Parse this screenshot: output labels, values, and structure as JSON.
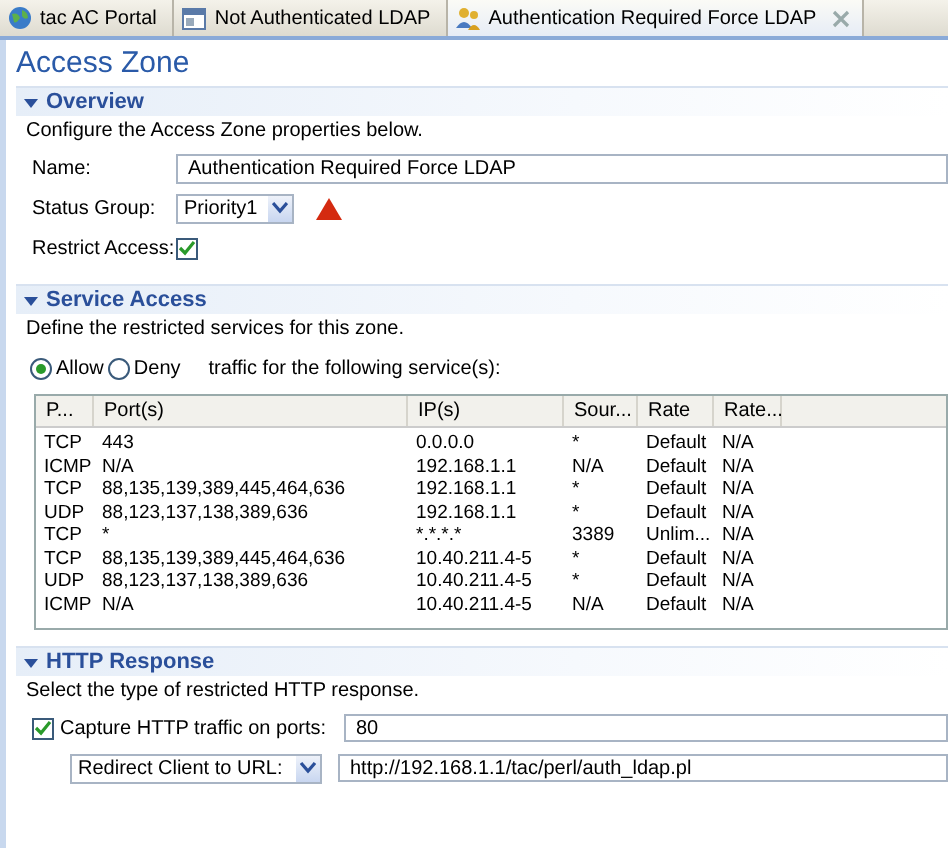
{
  "tabs": [
    {
      "label": "tac AC Portal",
      "selected": false,
      "kind": "globe"
    },
    {
      "label": "Not Authenticated LDAP",
      "selected": false,
      "kind": "form"
    },
    {
      "label": "Authentication Required Force LDAP",
      "selected": true,
      "kind": "user"
    }
  ],
  "page_title": "Access Zone",
  "overview": {
    "heading": "Overview",
    "expanded": true,
    "description": "Configure the Access Zone properties below.",
    "name": {
      "label": "Name:",
      "value": "Authentication Required Force LDAP"
    },
    "status_group": {
      "label": "Status Group:",
      "value": "Priority1",
      "warning": true
    },
    "restrict_access": {
      "label": "Restrict Access:",
      "checked": true
    }
  },
  "service_access": {
    "heading": "Service Access",
    "expanded": true,
    "description": "Define the restricted services for this zone.",
    "modes": [
      {
        "label": "Allow",
        "selected": true
      },
      {
        "label": "Deny",
        "selected": false
      }
    ],
    "mode_suffix": "traffic for the following service(s):",
    "table": {
      "columns": [
        "P...",
        "Port(s)",
        "IP(s)",
        "Sour...",
        "Rate",
        "Rate..."
      ],
      "rows": [
        [
          "TCP",
          "443",
          "0.0.0.0",
          "*",
          "Default",
          "N/A"
        ],
        [
          "ICMP",
          "N/A",
          "192.168.1.1",
          "N/A",
          "Default",
          "N/A"
        ],
        [
          "TCP",
          "88,135,139,389,445,464,636",
          "192.168.1.1",
          "*",
          "Default",
          "N/A"
        ],
        [
          "UDP",
          "88,123,137,138,389,636",
          "192.168.1.1",
          "*",
          "Default",
          "N/A"
        ],
        [
          "TCP",
          "*",
          "*.*.*.*",
          "3389",
          "Unlim...",
          "N/A"
        ],
        [
          "TCP",
          "88,135,139,389,445,464,636",
          "10.40.211.4-5",
          "*",
          "Default",
          "N/A"
        ],
        [
          "UDP",
          "88,123,137,138,389,636",
          "10.40.211.4-5",
          "*",
          "Default",
          "N/A"
        ],
        [
          "ICMP",
          "N/A",
          "10.40.211.4-5",
          "N/A",
          "Default",
          "N/A"
        ]
      ]
    }
  },
  "http_response": {
    "heading": "HTTP Response",
    "expanded": true,
    "description": "Select the type of restricted HTTP response.",
    "capture": {
      "label": "Capture HTTP traffic on ports:",
      "checked": true,
      "value": "80"
    },
    "action": {
      "value": "Redirect Client to URL:"
    },
    "url": {
      "value": "http://192.168.1.1/tac/perl/auth_ldap.pl"
    }
  }
}
